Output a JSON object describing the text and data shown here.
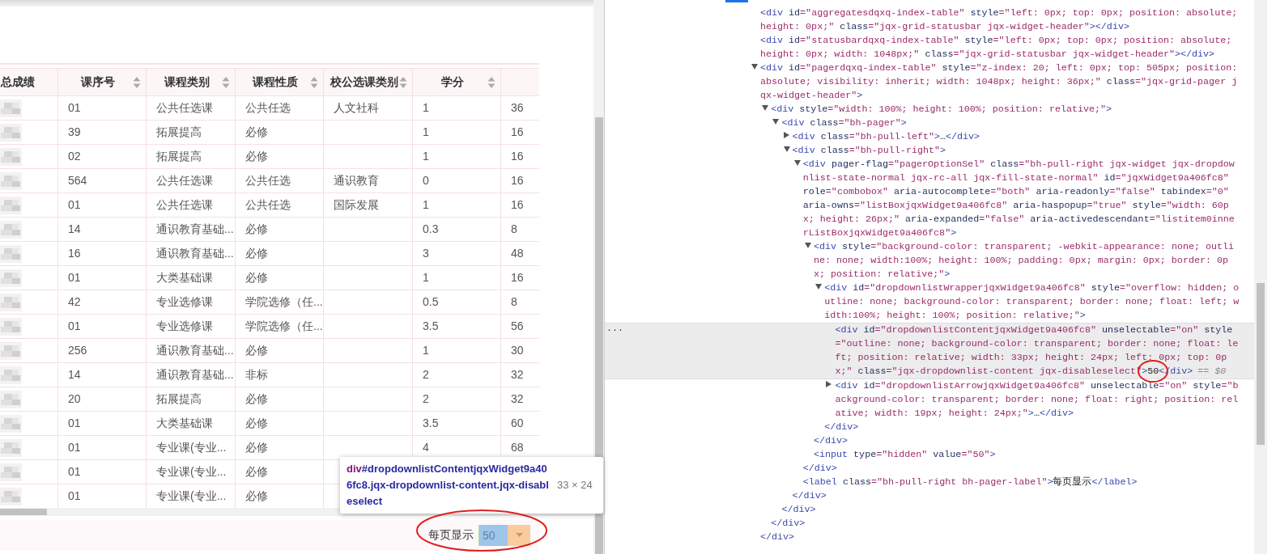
{
  "table": {
    "columns": [
      {
        "label": "总成绩",
        "sortable": false
      },
      {
        "label": "课序号",
        "sortable": true
      },
      {
        "label": "课程类别",
        "sortable": true
      },
      {
        "label": "课程性质",
        "sortable": true
      },
      {
        "label": "校公选课类别",
        "sortable": true
      },
      {
        "label": "学分",
        "sortable": true
      },
      {
        "sortable": false
      }
    ],
    "rows": [
      {
        "score_blurred": true,
        "cells": [
          "",
          "01",
          "公共任选课",
          "公共任选",
          "人文社科",
          "1",
          "36"
        ]
      },
      {
        "score_blurred": true,
        "cells": [
          "",
          "39",
          "拓展提高",
          "必修",
          "",
          "1",
          "16"
        ]
      },
      {
        "score_blurred": true,
        "cells": [
          "",
          "02",
          "拓展提高",
          "必修",
          "",
          "1",
          "16"
        ]
      },
      {
        "score_blurred": true,
        "cells": [
          "",
          "564",
          "公共任选课",
          "公共任选",
          "通识教育",
          "0",
          "16"
        ]
      },
      {
        "score_blurred": true,
        "cells": [
          "",
          "01",
          "公共任选课",
          "公共任选",
          "国际发展",
          "1",
          "16"
        ]
      },
      {
        "score_blurred": true,
        "cells": [
          "",
          "14",
          "通识教育基础...",
          "必修",
          "",
          "0.3",
          "8"
        ]
      },
      {
        "score_blurred": true,
        "cells": [
          "",
          "16",
          "通识教育基础...",
          "必修",
          "",
          "3",
          "48"
        ]
      },
      {
        "score_blurred": true,
        "cells": [
          "",
          "01",
          "大类基础课",
          "必修",
          "",
          "1",
          "16"
        ]
      },
      {
        "score_blurred": true,
        "cells": [
          "",
          "42",
          "专业选修课",
          "学院选修（任...",
          "",
          "0.5",
          "8"
        ]
      },
      {
        "score_blurred": true,
        "cells": [
          "",
          "01",
          "专业选修课",
          "学院选修（任...",
          "",
          "3.5",
          "56"
        ]
      },
      {
        "score_blurred": true,
        "cells": [
          "",
          "256",
          "通识教育基础...",
          "必修",
          "",
          "1",
          "30"
        ]
      },
      {
        "score_blurred": true,
        "cells": [
          "",
          "14",
          "通识教育基础...",
          "非标",
          "",
          "2",
          "32"
        ]
      },
      {
        "score_blurred": true,
        "cells": [
          "",
          "20",
          "拓展提高",
          "必修",
          "",
          "2",
          "32"
        ]
      },
      {
        "score_blurred": true,
        "cells": [
          "",
          "01",
          "大类基础课",
          "必修",
          "",
          "3.5",
          "60"
        ]
      },
      {
        "score_blurred": true,
        "cells": [
          "",
          "01",
          "专业课(专业...",
          "必修",
          "",
          "4",
          "68"
        ]
      },
      {
        "score_blurred": true,
        "cells": [
          "",
          "01",
          "专业课(专业...",
          "必修",
          "",
          "",
          ""
        ]
      },
      {
        "score_blurred": true,
        "cells": [
          "",
          "01",
          "专业课(专业...",
          "必修",
          "",
          "",
          ""
        ]
      }
    ]
  },
  "pager": {
    "label": "每页显示",
    "page_size": "50"
  },
  "tooltip": {
    "tag": "div",
    "selector": "#dropdownlistContentjqxWidget9a406fc8.jqx-dropdownlist-content.jqx-disableselect",
    "size": "33 × 24"
  },
  "elements_tree": [
    {
      "markup": "<div id=\"aggregatesdqxq-index-table\" style=\"left: 0px; top: 0px; position: absolute; height: 0px;\" class=\"jqx-grid-statusbar jqx-widget-header\"></div>",
      "selected": false
    },
    {
      "markup": "<div id=\"statusbardqxq-index-table\" style=\"left: 0px; top: 0px; position: absolute; height: 0px; width: 1048px;\" class=\"jqx-grid-statusbar jqx-widget-header\"></div>",
      "selected": false
    },
    {
      "markup": "<div id=\"pagerdqxq-index-table\" style=\"z-index: 20; left: 0px; top: 505px; position: absolute; visibility: inherit; width: 1048px; height: 36px;\" class=\"jqx-grid-pager jqx-widget-header\">",
      "selected": false,
      "expanded": true,
      "close": "</div>",
      "children": [
        {
          "markup": "<div style=\"width: 100%; height: 100%; position: relative;\">",
          "selected": false,
          "expanded": true,
          "close": "</div>",
          "children": [
            {
              "markup": "<div class=\"bh-pager\">",
              "selected": false,
              "expanded": true,
              "close": "</div>",
              "children": [
                {
                  "markup": "<div class=\"bh-pull-left\">…</div>",
                  "selected": false,
                  "expanded": false
                },
                {
                  "markup": "<div class=\"bh-pull-right\">",
                  "selected": false,
                  "expanded": true,
                  "close": "</div>",
                  "children": [
                    {
                      "markup": "<div pager-flag=\"pagerOptionSel\" class=\"bh-pull-right jqx-widget jqx-dropdownlist-state-normal jqx-rc-all jqx-fill-state-normal\" id=\"jqxWidget9a406fc8\" role=\"combobox\" aria-autocomplete=\"both\" aria-readonly=\"false\" tabindex=\"0\" aria-owns=\"listBoxjqxWidget9a406fc8\" aria-haspopup=\"true\" style=\"width: 60px; height: 26px;\" aria-expanded=\"false\" aria-activedescendant=\"listitem0innerListBoxjqxWidget9a406fc8\">",
                      "selected": false,
                      "expanded": true,
                      "close": "</div>",
                      "children": [
                        {
                          "markup": "<div style=\"background-color: transparent; -webkit-appearance: none; outline: none; width:100%; height: 100%; padding: 0px; margin: 0px; border: 0px; position: relative;\">",
                          "selected": false,
                          "expanded": true,
                          "close": "</div>",
                          "children": [
                            {
                              "markup": "<div id=\"dropdownlistWrapperjqxWidget9a406fc8\" style=\"overflow: hidden; outline: none; background-color: transparent; border: none; float: left; width:100%; height: 100%; position: relative;\">",
                              "selected": false,
                              "expanded": true,
                              "close": "</div>",
                              "children": [
                                {
                                  "markup": "<div id=\"dropdownlistContentjqxWidget9a406fc8\" unselectable=\"on\" style=\"outline: none; background-color: transparent; border: none; float: left; position: relative; width: 33px; height: 24px; left: 0px; top: 0px;\" class=\"jqx-dropdownlist-content jqx-disableselect\">50</div>",
                                  "selected": true,
                                  "gutter": "···",
                                  "suffix": "== $0"
                                },
                                {
                                  "markup": "<div id=\"dropdownlistArrowjqxWidget9a406fc8\" unselectable=\"on\" style=\"background-color: transparent; border: none; float: right; position: relative; width: 19px; height: 24px;\">…</div>",
                                  "selected": false,
                                  "expanded": false
                                }
                              ]
                            }
                          ]
                        },
                        {
                          "markup": "<input type=\"hidden\" value=\"50\">",
                          "selected": false
                        }
                      ]
                    },
                    {
                      "markup": "<label class=\"bh-pull-right bh-pager-label\">每页显示</label>",
                      "selected": false
                    }
                  ]
                }
              ]
            }
          ]
        }
      ]
    }
  ]
}
